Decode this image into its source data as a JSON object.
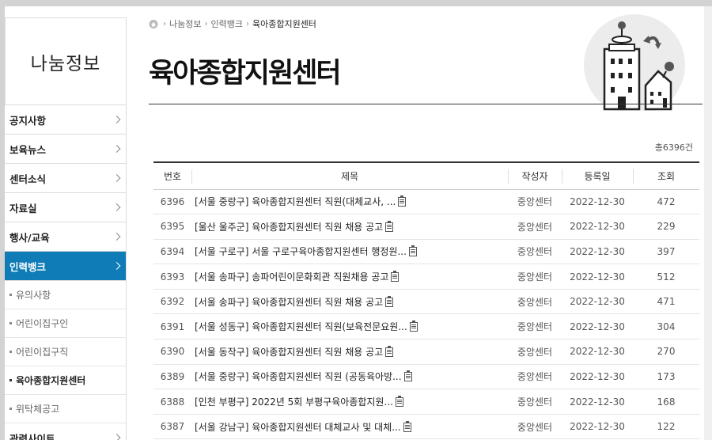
{
  "sidebar": {
    "title": "나눔정보",
    "menu": [
      {
        "label": "공지사항"
      },
      {
        "label": "보육뉴스"
      },
      {
        "label": "센터소식"
      },
      {
        "label": "자료실"
      },
      {
        "label": "행사/교육"
      },
      {
        "label": "인력뱅크"
      }
    ],
    "submenu": [
      {
        "label": "유의사항"
      },
      {
        "label": "어린이집구인"
      },
      {
        "label": "어린이집구직"
      },
      {
        "label": "육아종합지원센터"
      },
      {
        "label": "위탁체공고"
      }
    ],
    "next_menu": {
      "label": "관련사이트"
    }
  },
  "breadcrumb": {
    "items": [
      "나눔정보",
      "인력뱅크",
      "육아종합지원센터"
    ]
  },
  "page": {
    "title": "육아종합지원센터",
    "total": "총6396건"
  },
  "table": {
    "headers": [
      "번호",
      "제목",
      "작성자",
      "등록일",
      "조회"
    ],
    "rows": [
      {
        "no": "6396",
        "subject": "[서울 중랑구] 육아종합지원센터 직원(대체교사, ...",
        "author": "중앙센터",
        "date": "2022-12-30",
        "views": "472"
      },
      {
        "no": "6395",
        "subject": "[울산 울주군] 육아종합지원센터 직원 채용 공고",
        "author": "중앙센터",
        "date": "2022-12-30",
        "views": "229"
      },
      {
        "no": "6394",
        "subject": "[서울 구로구] 서울 구로구육아종합지원센터 행정원...",
        "author": "중앙센터",
        "date": "2022-12-30",
        "views": "397"
      },
      {
        "no": "6393",
        "subject": "[서울 송파구] 송파어린이문화회관 직원채용 공고",
        "author": "중앙센터",
        "date": "2022-12-30",
        "views": "512"
      },
      {
        "no": "6392",
        "subject": "[서울 송파구] 육아종합지원센터 직원 채용 공고",
        "author": "중앙센터",
        "date": "2022-12-30",
        "views": "471"
      },
      {
        "no": "6391",
        "subject": "[서울 성동구] 육아종합지원센터 직원(보육전문요원...",
        "author": "중앙센터",
        "date": "2022-12-30",
        "views": "304"
      },
      {
        "no": "6390",
        "subject": "[서울 동작구] 육아종합지원센터 직원 채용 공고",
        "author": "중앙센터",
        "date": "2022-12-30",
        "views": "270"
      },
      {
        "no": "6389",
        "subject": "[서울 중랑구] 육아종합지원센터 직원 (공동육아방...",
        "author": "중앙센터",
        "date": "2022-12-30",
        "views": "173"
      },
      {
        "no": "6388",
        "subject": "[인천 부평구] 2022년 5회 부평구육아종합지원...",
        "author": "중앙센터",
        "date": "2022-12-30",
        "views": "168"
      },
      {
        "no": "6387",
        "subject": "[서울 강남구] 육아종합지원센터 대체교사 및 대체...",
        "author": "중앙센터",
        "date": "2022-12-30",
        "views": "122"
      }
    ]
  },
  "colors": {
    "accent": "#0f7cb7",
    "background": "#d3d3d3"
  },
  "icons": {
    "home": "home-icon",
    "attachment": "document-icon",
    "menu_arrow": "chevron-right-icon"
  }
}
